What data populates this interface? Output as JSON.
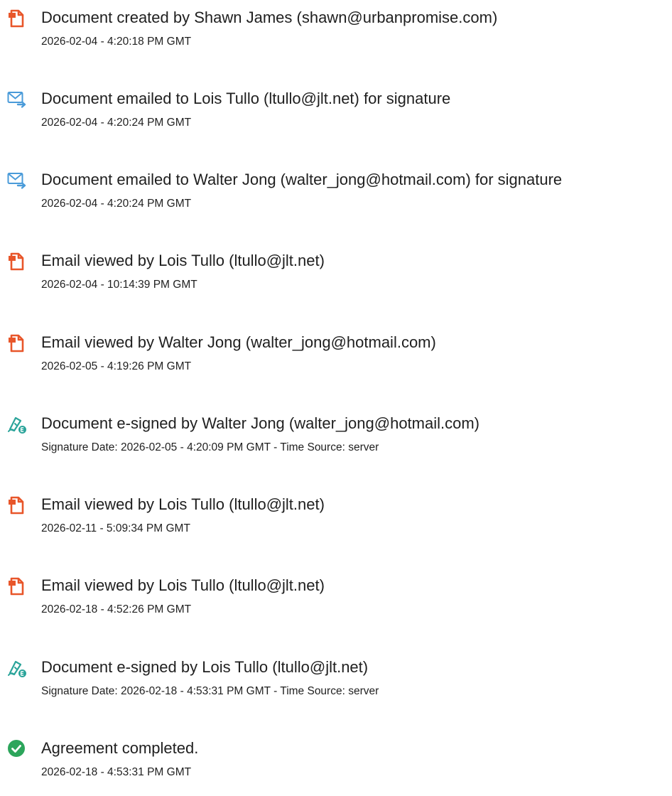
{
  "colors": {
    "created_icon": "#E8562A",
    "email_icon": "#4A9BD9",
    "signed_icon": "#2BA49A",
    "completed_icon": "#2CA55B"
  },
  "events": [
    {
      "icon": "document-icon",
      "title": "Document created by Shawn James (shawn@urbanpromise.com)",
      "detail": "2026-02-04 - 4:20:18 PM GMT"
    },
    {
      "icon": "email-sent-icon",
      "title": "Document emailed to Lois Tullo (ltullo@jlt.net) for signature",
      "detail": "2026-02-04 - 4:20:24 PM GMT"
    },
    {
      "icon": "email-sent-icon",
      "title": "Document emailed to Walter Jong (walter_jong@hotmail.com) for signature",
      "detail": "2026-02-04 - 4:20:24 PM GMT"
    },
    {
      "icon": "document-icon",
      "title": "Email viewed by Lois Tullo (ltullo@jlt.net)",
      "detail": "2026-02-04 - 10:14:39 PM GMT"
    },
    {
      "icon": "document-icon",
      "title": "Email viewed by Walter Jong (walter_jong@hotmail.com)",
      "detail": "2026-02-05 - 4:19:26 PM GMT"
    },
    {
      "icon": "e-sign-icon",
      "title": "Document e-signed by Walter Jong (walter_jong@hotmail.com)",
      "detail": "Signature Date: 2026-02-05 - 4:20:09 PM GMT - Time Source: server"
    },
    {
      "icon": "document-icon",
      "title": "Email viewed by Lois Tullo (ltullo@jlt.net)",
      "detail": "2026-02-11 - 5:09:34 PM GMT"
    },
    {
      "icon": "document-icon",
      "title": "Email viewed by Lois Tullo (ltullo@jlt.net)",
      "detail": "2026-02-18 - 4:52:26 PM GMT"
    },
    {
      "icon": "e-sign-icon",
      "title": "Document e-signed by Lois Tullo (ltullo@jlt.net)",
      "detail": "Signature Date: 2026-02-18 - 4:53:31 PM GMT - Time Source: server"
    },
    {
      "icon": "check-circle-icon",
      "title": "Agreement completed.",
      "detail": "2026-02-18 - 4:53:31 PM GMT"
    }
  ]
}
